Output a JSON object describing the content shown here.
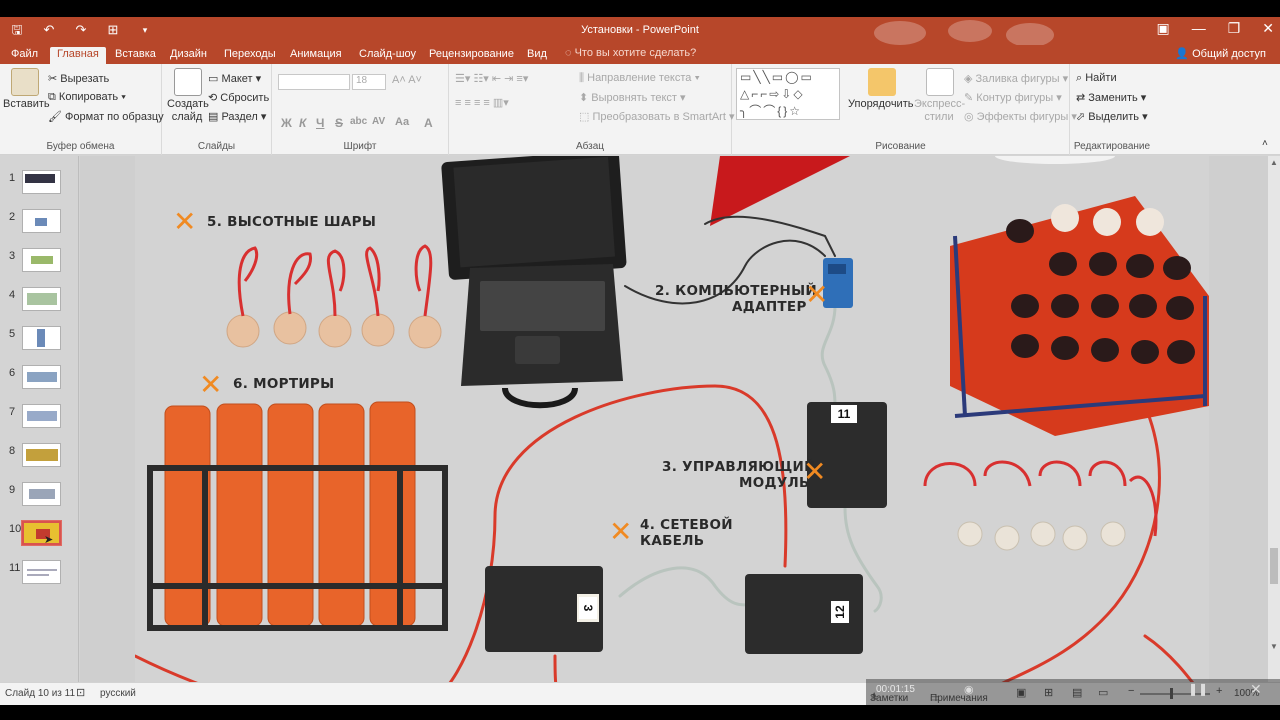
{
  "window": {
    "title": "Установки - PowerPoint",
    "quick_access": [
      "save-icon",
      "undo-icon",
      "redo-icon",
      "present-icon",
      "customize-icon"
    ],
    "controls": [
      "restore-ribbon-icon",
      "minimize-icon",
      "maximize-icon",
      "close-icon"
    ]
  },
  "tabs": {
    "items": [
      "Файл",
      "Главная",
      "Вставка",
      "Дизайн",
      "Переходы",
      "Анимация",
      "Слайд-шоу",
      "Рецензирование",
      "Вид"
    ],
    "active": "Главная",
    "tell_me": "Что вы хотите сделать?",
    "share": "Общий доступ"
  },
  "ribbon": {
    "clipboard": {
      "label": "Буфер обмена",
      "paste": "Вставить",
      "cut": "Вырезать",
      "copy": "Копировать",
      "format_painter": "Формат по образцу"
    },
    "slides": {
      "label": "Слайды",
      "new_slide": "Создать слайд",
      "layout": "Макет",
      "reset": "Сбросить",
      "section": "Раздел"
    },
    "font": {
      "label": "Шрифт",
      "font_name": "",
      "font_size": "18",
      "bold": "Ж",
      "italic": "К",
      "underline": "Ч",
      "strike": "S",
      "shadow": "abc",
      "spacing": "AV",
      "case": "Aa",
      "color": "A"
    },
    "paragraph": {
      "label": "Абзац",
      "text_direction": "Направление текста",
      "align_text": "Выровнять текст",
      "smartart": "Преобразовать в SmartArt"
    },
    "drawing": {
      "label": "Рисование",
      "arrange": "Упорядочить",
      "quick_styles": "Экспресс-стили",
      "fill": "Заливка фигуры",
      "outline": "Контур фигуры",
      "effects": "Эффекты фигуры"
    },
    "editing": {
      "label": "Редактирование",
      "find": "Найти",
      "replace": "Заменить",
      "select": "Выделить"
    }
  },
  "slides_pane": {
    "numbers": [
      "1",
      "2",
      "3",
      "4",
      "5",
      "6",
      "7",
      "8",
      "9",
      "10",
      "11"
    ],
    "selected": "10"
  },
  "slide": {
    "labels": {
      "balloons": "5. ВЫСОТНЫЕ ШАРЫ",
      "mortars": "6. МОРТИРЫ",
      "adapter_l1": "2. КОМПЬЮТЕРНЫЙ",
      "adapter_l2": "АДАПТЕР",
      "module_l1": "3. УПРАВЛЯЮЩИЙ",
      "module_l2": "МОДУЛЬ",
      "cable_l1": "4. СЕТЕВОЙ",
      "cable_l2": "КАБЕЛЬ"
    },
    "marker": "✕",
    "module_numbers": [
      "11",
      "3",
      "12"
    ],
    "colors": {
      "accent": "#b7472a",
      "mortar": "#e8642a",
      "tube": "#e2401c",
      "marker": "#f08a22",
      "cable": "#d93a2a"
    }
  },
  "statusbar": {
    "slide_info": "Слайд 10 из 11",
    "language": "русский",
    "notes": "Заметки",
    "comments": "Примечания",
    "zoom": "100%",
    "video_time": "00:01:15"
  }
}
